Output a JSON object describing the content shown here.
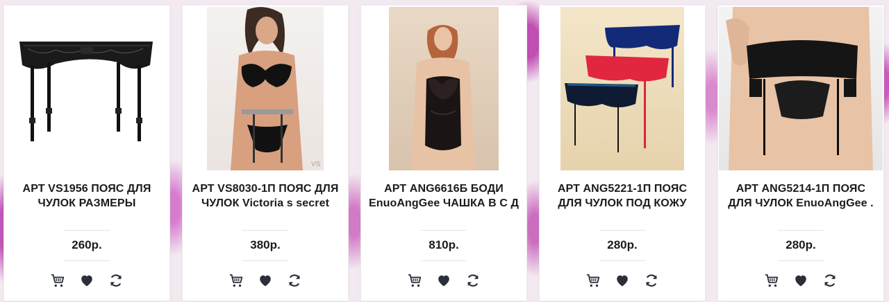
{
  "products": [
    {
      "title": "АРТ VS1956 ПОЯС ДЛЯ ЧУЛОК РАЗМЕРЫ",
      "price": "260р.",
      "image_desc": "black-lace-garter-belt"
    },
    {
      "title": "АРТ VS8030-1П ПОЯС ДЛЯ ЧУЛОК Victoria s secret",
      "price": "380р.",
      "image_desc": "model-black-lingerie-set"
    },
    {
      "title": "АРТ ANG6616Б БОДИ EnuoAngGee ЧАШКА В С Д",
      "price": "810р.",
      "image_desc": "model-black-lace-bodysuit"
    },
    {
      "title": "АРТ ANG5221-1П ПОЯС ДЛЯ ЧУЛОК ПОД КОЖУ",
      "price": "280р.",
      "image_desc": "three-garter-belts-blue-red-navy"
    },
    {
      "title": "АРТ ANG5214-1П ПОЯС ДЛЯ ЧУЛОК EnuoAngGee .",
      "price": "280р.",
      "image_desc": "model-leather-garter-belt"
    }
  ],
  "icons": {
    "cart": "cart-icon",
    "wishlist": "heart-icon",
    "compare": "compare-icon"
  },
  "colors": {
    "icon": "#2b2f3a",
    "text": "#1b1b1b",
    "card_bg": "#ffffff"
  }
}
